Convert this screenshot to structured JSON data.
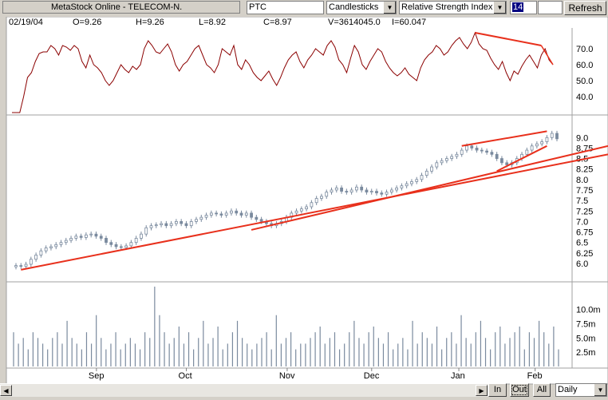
{
  "toolbar": {
    "app_title": "MetaStock Online - TELECOM-N.",
    "symbol": "PTC",
    "chart_style": "Candlesticks",
    "indicator": "Relative Strength Index",
    "period": "14",
    "refresh_label": "Refresh"
  },
  "info": {
    "date": "02/19/04",
    "open": "O=9.26",
    "high": "H=9.26",
    "low": "L=8.92",
    "close": "C=8.97",
    "volume": "V=3614045.0",
    "indicator_value": "I=60.047"
  },
  "footer": {
    "in_label": "In",
    "out_label": "Out",
    "all_label": "All",
    "interval": "Daily"
  },
  "colors": {
    "rsi_line": "#8b0000",
    "trendline": "#e8301c",
    "candle": "#7a8a9e",
    "volume": "#7a8a9e",
    "grid_border": "#a0a0a0"
  },
  "chart_data": [
    {
      "type": "line",
      "name_shown": "",
      "ylabel_ticks": [
        "70.0",
        "60.0",
        "50.0",
        "40.0"
      ],
      "yticks": [
        70,
        60,
        50,
        40
      ],
      "ylim": [
        30,
        80
      ],
      "values": [
        30,
        30,
        30,
        40,
        52,
        55,
        62,
        67,
        68,
        68,
        72,
        70,
        66,
        72,
        71,
        69,
        72,
        70,
        62,
        58,
        66,
        60,
        58,
        55,
        50,
        47,
        50,
        55,
        60,
        57,
        55,
        59,
        57,
        60,
        70,
        75,
        72,
        68,
        67,
        70,
        73,
        68,
        60,
        56,
        60,
        62,
        66,
        70,
        72,
        66,
        60,
        58,
        55,
        60,
        70,
        68,
        66,
        72,
        60,
        57,
        63,
        60,
        55,
        52,
        50,
        53,
        56,
        51,
        47,
        52,
        58,
        63,
        66,
        68,
        62,
        58,
        63,
        66,
        70,
        68,
        66,
        72,
        75,
        71,
        63,
        60,
        55,
        64,
        72,
        68,
        60,
        57,
        62,
        66,
        70,
        68,
        62,
        58,
        55,
        53,
        55,
        58,
        54,
        52,
        50,
        58,
        63,
        66,
        68,
        72,
        70,
        66,
        68,
        72,
        75,
        77,
        73,
        70,
        74,
        80,
        73,
        70,
        69,
        64,
        60,
        57,
        62,
        55,
        50,
        56,
        54,
        59,
        63,
        66,
        62,
        58,
        66,
        70,
        63,
        60
      ],
      "annotations": "downward red trendline from the January peak to the February peak"
    },
    {
      "type": "candlestick",
      "ylabel_ticks": [
        "9.0",
        "8.75",
        "8.5",
        "8.25",
        "8.0",
        "7.75",
        "7.5",
        "7.25",
        "7.0",
        "6.75",
        "6.5",
        "6.25",
        "6.0"
      ],
      "yticks": [
        9.0,
        8.75,
        8.5,
        8.25,
        8.0,
        7.75,
        7.5,
        7.25,
        7.0,
        6.75,
        6.5,
        6.25,
        6.0
      ],
      "ylim": [
        5.6,
        9.5
      ],
      "close": [
        5.95,
        5.93,
        5.98,
        6.1,
        6.2,
        6.3,
        6.37,
        6.4,
        6.45,
        6.5,
        6.55,
        6.6,
        6.65,
        6.62,
        6.68,
        6.7,
        6.65,
        6.6,
        6.5,
        6.45,
        6.4,
        6.38,
        6.42,
        6.5,
        6.6,
        6.7,
        6.85,
        6.9,
        6.92,
        6.95,
        6.9,
        6.95,
        7.0,
        6.95,
        6.9,
        7.0,
        7.05,
        7.1,
        7.15,
        7.2,
        7.18,
        7.15,
        7.2,
        7.25,
        7.2,
        7.15,
        7.2,
        7.1,
        7.05,
        7.0,
        6.95,
        6.9,
        6.95,
        7.0,
        7.1,
        7.2,
        7.25,
        7.3,
        7.35,
        7.45,
        7.55,
        7.6,
        7.7,
        7.75,
        7.8,
        7.72,
        7.7,
        7.75,
        7.82,
        7.75,
        7.7,
        7.72,
        7.68,
        7.65,
        7.7,
        7.75,
        7.8,
        7.85,
        7.9,
        7.95,
        8.0,
        8.1,
        8.2,
        8.3,
        8.4,
        8.45,
        8.5,
        8.55,
        8.6,
        8.7,
        8.8,
        8.75,
        8.7,
        8.68,
        8.65,
        8.6,
        8.5,
        8.4,
        8.35,
        8.4,
        8.5,
        8.6,
        8.7,
        8.8,
        8.85,
        8.9,
        9.0,
        9.1,
        8.97
      ],
      "annotations": "red rising channel lines and two long-term red support trendlines"
    },
    {
      "type": "bar",
      "name_shown": "",
      "ylabel_ticks": [
        "10.0m",
        "7.5m",
        "5.0m",
        "2.5m"
      ],
      "yticks": [
        10,
        7.5,
        5,
        2.5
      ],
      "ylim": [
        0,
        14
      ],
      "values": [
        6,
        4,
        5,
        3,
        6,
        5,
        4,
        3,
        5,
        6,
        4,
        8,
        5,
        4,
        3,
        6,
        4,
        9,
        5,
        3,
        4,
        6,
        3,
        4,
        5,
        4,
        3,
        6,
        5,
        14,
        9,
        6,
        4,
        5,
        7,
        4,
        6,
        3,
        5,
        8,
        4,
        5,
        7,
        3,
        4,
        6,
        8,
        5,
        4,
        3,
        4,
        5,
        6,
        3,
        9,
        4,
        5,
        6,
        3,
        4,
        4,
        5,
        6,
        7,
        4,
        5,
        6,
        3,
        4,
        6,
        8,
        5,
        4,
        6,
        7,
        5,
        4,
        6,
        3,
        4,
        5,
        3,
        8,
        4,
        6,
        5,
        4,
        7,
        3,
        5,
        6,
        4,
        9,
        5,
        4,
        6,
        8,
        5,
        3,
        6,
        7,
        4,
        5,
        6,
        7,
        3,
        6,
        5,
        8,
        6,
        4,
        7,
        3
      ]
    }
  ],
  "axis": {
    "months": [
      "Sep",
      "Oct",
      "Nov",
      "Dec",
      "Jan",
      "Feb"
    ]
  }
}
